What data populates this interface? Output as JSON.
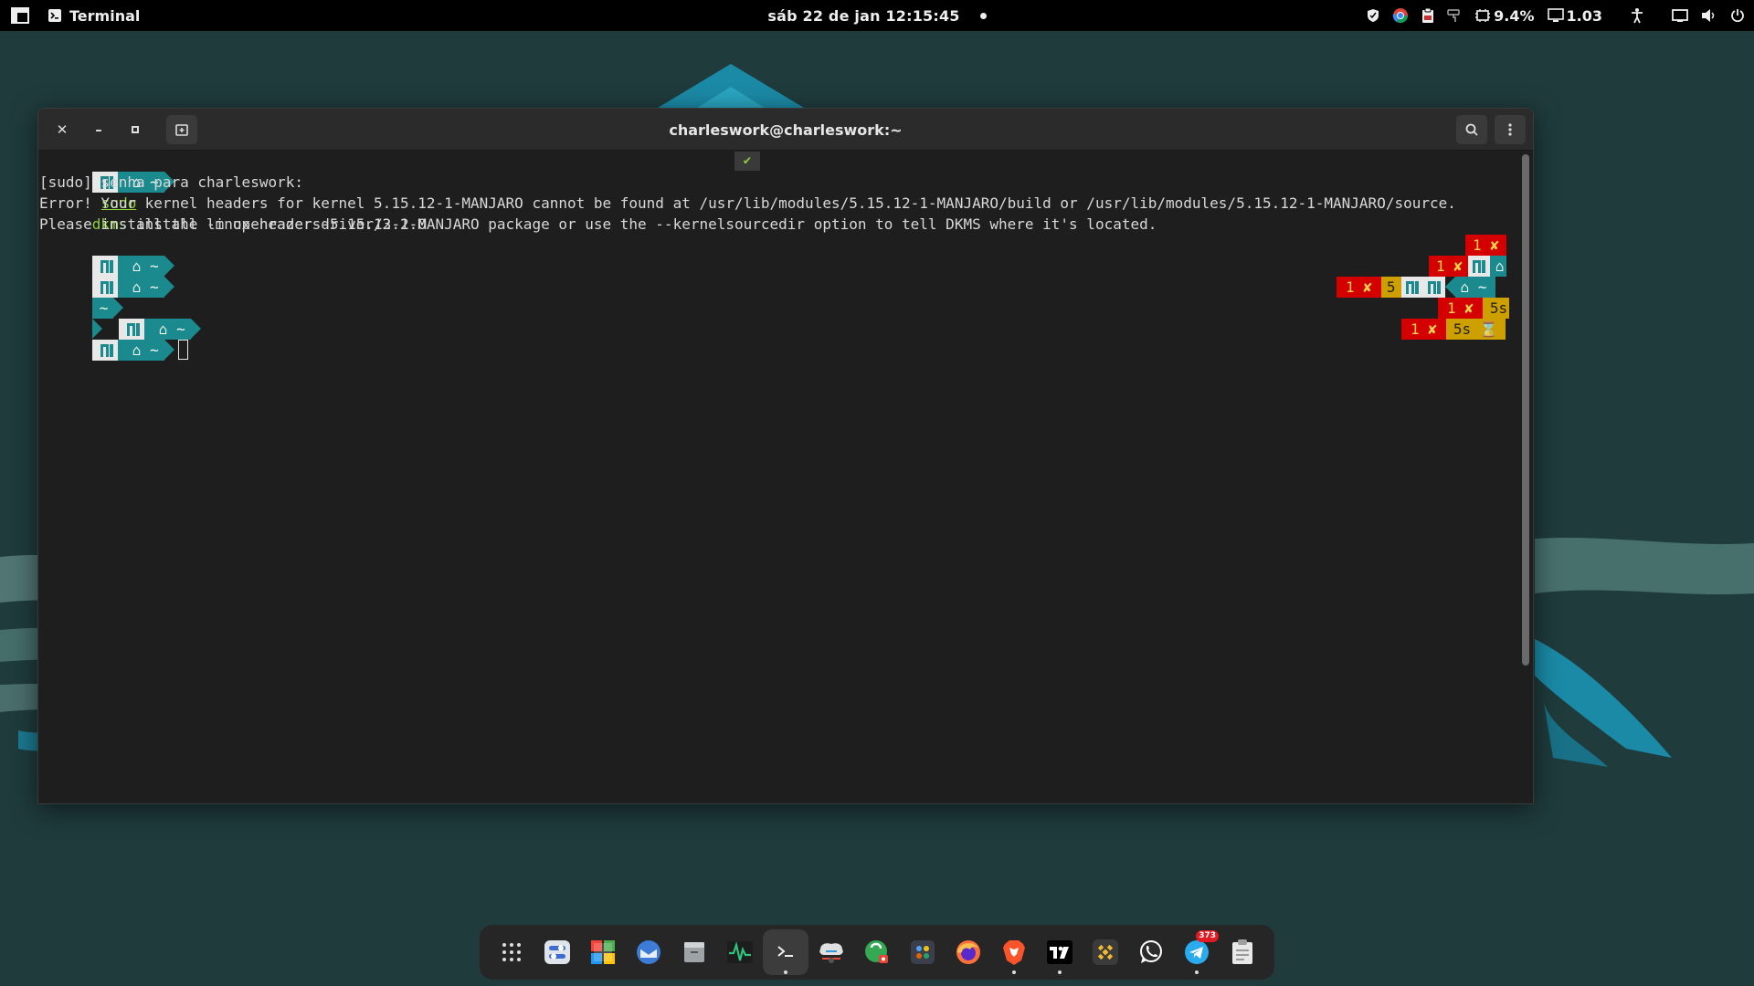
{
  "topbar": {
    "app_name": "Terminal",
    "clock": "sáb 22 de jan  12:15:45",
    "cpu": "9.4%",
    "load": "1.03",
    "icons": [
      "activities-icon",
      "terminal-icon",
      "shield-icon",
      "chrome-icon",
      "clipboard-icon",
      "paint-icon",
      "cpu-icon",
      "monitor-icon",
      "accessibility-icon",
      "screen-icon",
      "volume-icon",
      "power-icon"
    ]
  },
  "window": {
    "title": "charleswork@charleswork:~"
  },
  "terminal": {
    "home": "~",
    "cmd_sudo": "sudo",
    "cmd_dkms": "dkms",
    "cmd_rest": " install -m openrazer-driver/3.2.0",
    "ok": "✔",
    "line2": "[sudo] senha para charleswork:",
    "line3": "Error! Your kernel headers for kernel 5.15.12-1-MANJARO cannot be found at /usr/lib/modules/5.15.12-1-MANJARO/build or /usr/lib/modules/5.15.12-1-MANJARO/source.",
    "line4": "Please install the linux-headers-5.15.12-1-MANJARO package or use the --kernelsourcedir option to tell DKMS where it's located.",
    "rp1_code": "1",
    "rp_x": "✘",
    "rp3_jobs": "5",
    "rp_time": "5s",
    "rp_hourglass": "⌛"
  },
  "dock": {
    "items": [
      "apps-grid-icon",
      "settings-icon",
      "software-store-icon",
      "mail-icon",
      "files-icon",
      "system-monitor-icon",
      "terminal-icon",
      "network-icon",
      "vpn-icon",
      "screenshot-icon",
      "firefox-icon",
      "brave-icon",
      "tradingview-icon",
      "binance-icon",
      "whatsapp-icon",
      "telegram-icon",
      "clipboard-icon"
    ],
    "telegram_badge": "373"
  },
  "colors": {
    "teal": "#1a8a8e",
    "red": "#d40000",
    "gold": "#cda000",
    "green": "#8ed13a"
  }
}
